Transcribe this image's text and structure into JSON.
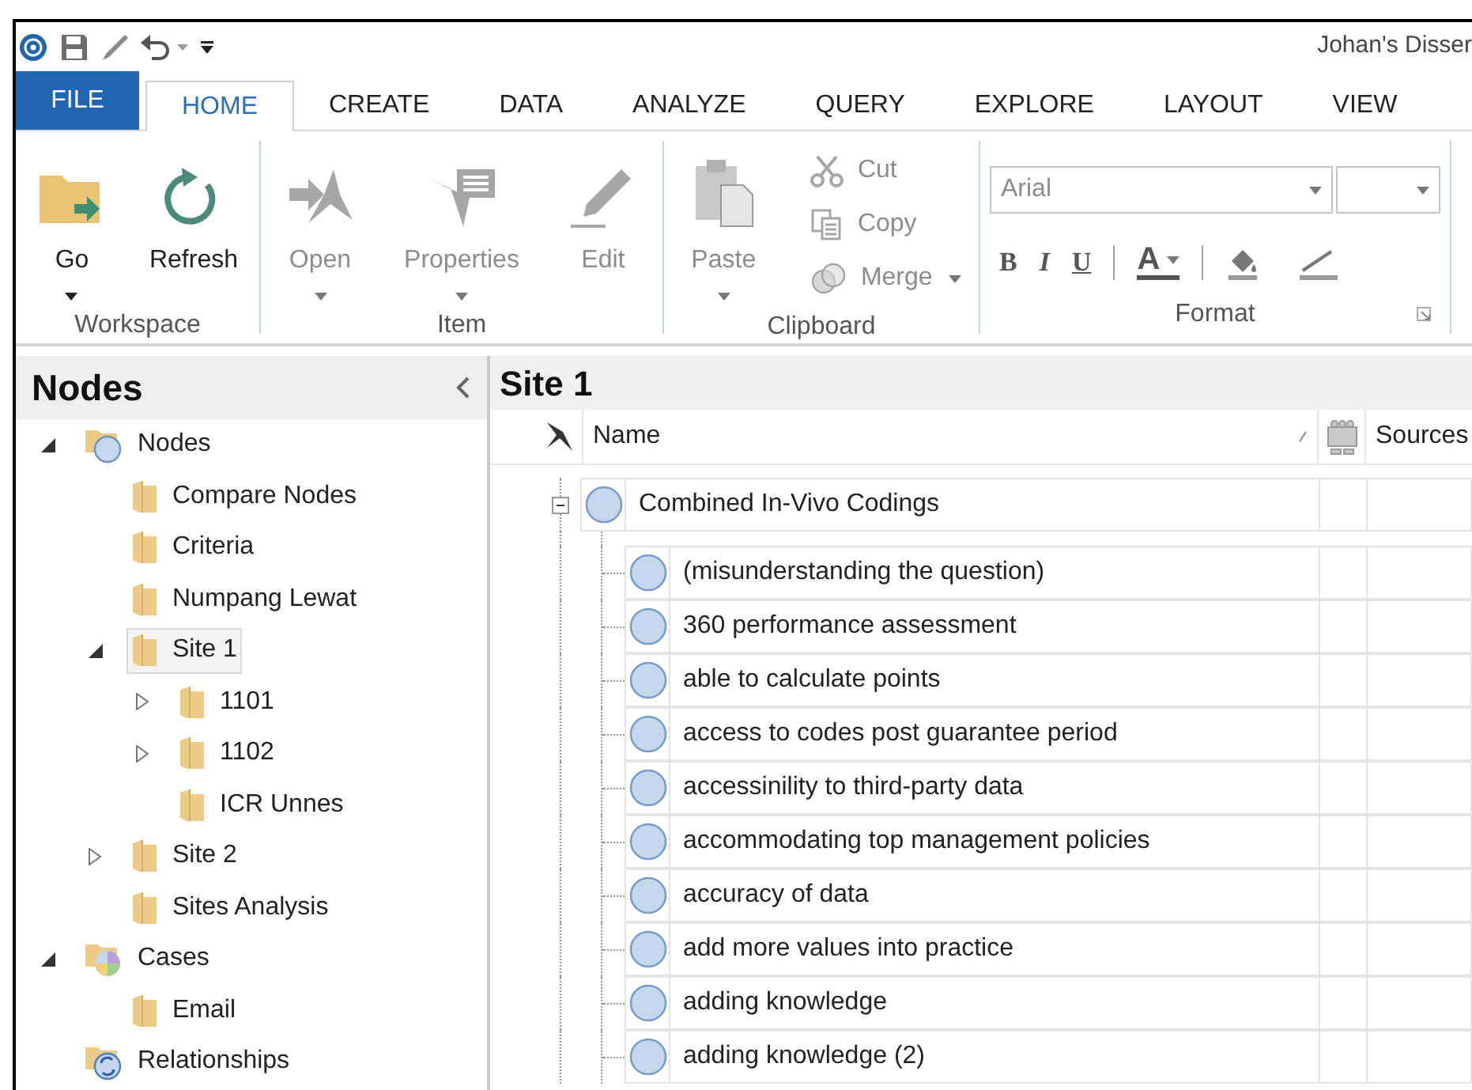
{
  "title_bar": {
    "title": "Johan's Disser"
  },
  "ribbon_tabs": [
    {
      "label": "FILE",
      "kind": "file",
      "selected": false
    },
    {
      "label": "HOME",
      "kind": "tab",
      "selected": true
    },
    {
      "label": "CREATE",
      "kind": "tab",
      "selected": false
    },
    {
      "label": "DATA",
      "kind": "tab",
      "selected": false
    },
    {
      "label": "ANALYZE",
      "kind": "tab",
      "selected": false
    },
    {
      "label": "QUERY",
      "kind": "tab",
      "selected": false
    },
    {
      "label": "EXPLORE",
      "kind": "tab",
      "selected": false
    },
    {
      "label": "LAYOUT",
      "kind": "tab",
      "selected": false
    },
    {
      "label": "VIEW",
      "kind": "tab",
      "selected": false
    }
  ],
  "ribbon_groups": [
    {
      "label": "Workspace",
      "large_buttons": [
        {
          "label": "Go",
          "kind": "go",
          "disabled": false,
          "dropdown": true
        },
        {
          "label": "Refresh",
          "kind": "refresh",
          "disabled": false,
          "dropdown": false
        }
      ]
    },
    {
      "label": "Item",
      "large_buttons": [
        {
          "label": "Open",
          "kind": "open",
          "disabled": true,
          "dropdown": true
        },
        {
          "label": "Properties",
          "kind": "properties",
          "disabled": true,
          "dropdown": true
        },
        {
          "label": "Edit",
          "kind": "edit",
          "disabled": true,
          "dropdown": false
        }
      ]
    },
    {
      "label": "Clipboard",
      "large_buttons": [
        {
          "label": "Paste",
          "kind": "paste",
          "disabled": true,
          "dropdown": true
        }
      ],
      "small_buttons": [
        {
          "label": "Cut",
          "kind": "cut",
          "disabled": true,
          "dropdown": false
        },
        {
          "label": "Copy",
          "kind": "copy",
          "disabled": true,
          "dropdown": false
        },
        {
          "label": "Merge",
          "kind": "merge",
          "disabled": true,
          "dropdown": true
        }
      ]
    },
    {
      "label": "Format",
      "font_field": {
        "value": "Arial"
      },
      "format_buttons": [
        {
          "label": "B",
          "kind": "bold"
        },
        {
          "label": "I",
          "kind": "italic"
        },
        {
          "label": "U",
          "kind": "underline"
        },
        {
          "label": "A",
          "kind": "font-color"
        },
        {
          "kind": "fill"
        },
        {
          "kind": "line"
        }
      ]
    }
  ],
  "navigation": {
    "title": "Nodes",
    "tree": [
      {
        "label": "Nodes",
        "kind": "nodes",
        "expanded": true,
        "selected": false,
        "children": [
          {
            "label": "Compare Nodes",
            "kind": "folder",
            "selected": false
          },
          {
            "label": "Criteria",
            "kind": "folder",
            "selected": false
          },
          {
            "label": "Numpang Lewat",
            "kind": "folder",
            "selected": false
          },
          {
            "label": "Site 1",
            "kind": "folder",
            "expanded": true,
            "selected": true,
            "children": [
              {
                "label": "1101",
                "kind": "folder",
                "expanded": false,
                "selected": false
              },
              {
                "label": "1102",
                "kind": "folder",
                "expanded": false,
                "selected": false
              },
              {
                "label": "ICR Unnes",
                "kind": "folder",
                "selected": false
              }
            ]
          },
          {
            "label": "Site 2",
            "kind": "folder",
            "expanded": false,
            "selected": false
          },
          {
            "label": "Sites Analysis",
            "kind": "folder",
            "selected": false
          }
        ]
      },
      {
        "label": "Cases",
        "kind": "cases",
        "expanded": true,
        "selected": false,
        "children": [
          {
            "label": "Email",
            "kind": "folder",
            "selected": false
          }
        ]
      },
      {
        "label": "Relationships",
        "kind": "relationships",
        "selected": false
      }
    ]
  },
  "detail": {
    "title": "Site 1",
    "columns": [
      "Name",
      "Sources"
    ],
    "rows": [
      {
        "name": "Combined In-Vivo Codings",
        "expanded": true,
        "children": [
          {
            "name": "(misunderstanding the question)"
          },
          {
            "name": "360 performance assessment"
          },
          {
            "name": "able to calculate points"
          },
          {
            "name": "access to codes post guarantee period"
          },
          {
            "name": "accessinility to third-party data"
          },
          {
            "name": "accommodating top management policies"
          },
          {
            "name": "accuracy of data"
          },
          {
            "name": "add more values into practice"
          },
          {
            "name": "adding knowledge"
          },
          {
            "name": "adding knowledge (2)"
          }
        ]
      }
    ]
  }
}
